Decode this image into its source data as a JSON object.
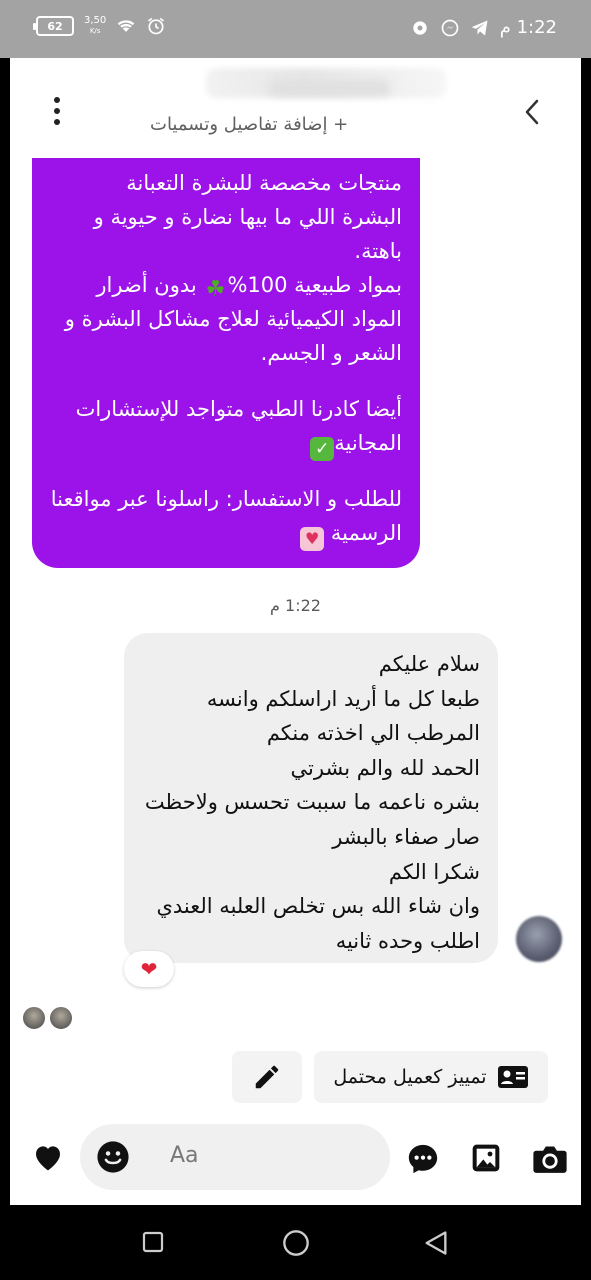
{
  "status_bar": {
    "battery": "62",
    "speed_top": "3,50",
    "speed_bottom": "K/s",
    "time": "1:22 م"
  },
  "header": {
    "subtitle": "+ إضافة تفاصيل وتسميات"
  },
  "outgoing_message": {
    "lines": [
      "منتجات مخصصة للبشرة التعبانة",
      "البشرة اللي ما بيها نضارة و حيوية و",
      "باهتة.",
      "بمواد طبيعية 100%",
      "بدون أضرار",
      "المواد الكيميائية لعلاج مشاكل البشرة و",
      "الشعر و الجسم.",
      "أيضا كادرنا الطبي متواجد للإستشارات",
      "المجانية",
      "للطلب و الاستفسار: راسلونا عبر مواقعنا",
      "الرسمية"
    ]
  },
  "timestamp": "1:22 م",
  "incoming_message": {
    "lines": [
      "سلام عليكم",
      "طبعا كل ما أريد اراسلكم وانسه",
      "المرطب الي اخذته منكم",
      "الحمد لله والم بشرتي",
      "بشره ناعمه ما سببت تحسس ولاحظت",
      "صار صفاء بالبشر",
      "شكرا الكم",
      "وان شاء الله بس تخلص العلبه العندي",
      "اطلب وحده ثانيه"
    ],
    "reaction": "❤"
  },
  "actions": {
    "tag_label": "تمييز كعميل محتمل"
  },
  "composer": {
    "placeholder": "Aa"
  },
  "colors": {
    "outgoing_bubble": "#9b13e8",
    "incoming_bubble": "#efefef",
    "status_bar": "#a3a3a3"
  }
}
